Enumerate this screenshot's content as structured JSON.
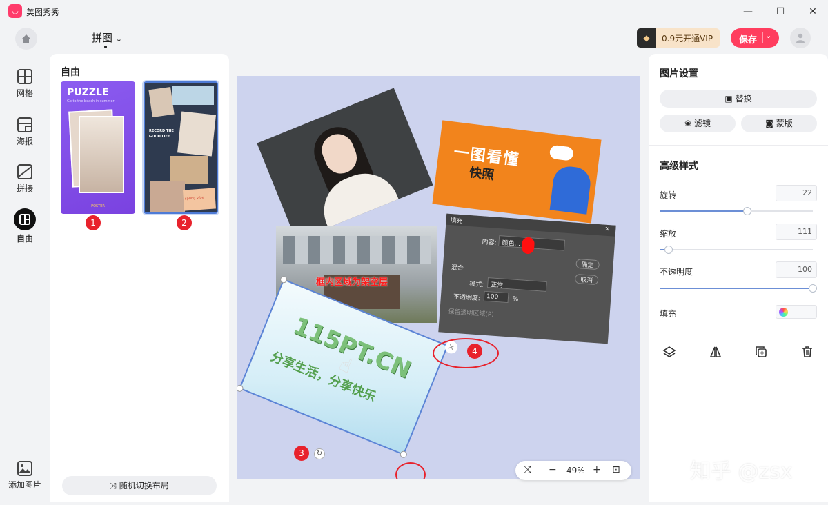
{
  "app": {
    "title": "美图秀秀",
    "logo_text": "◡"
  },
  "window": {
    "minimize": "—",
    "maximize": "☐",
    "close": "✕"
  },
  "topbar": {
    "layout_title": "拼图",
    "layout_caret": "⌄",
    "vip_text": "0.9元开通VIP",
    "save_label": "保存",
    "save_caret": "⌄"
  },
  "sidenav": {
    "items": [
      {
        "label": "网格"
      },
      {
        "label": "海报"
      },
      {
        "label": "拼接"
      },
      {
        "label": "自由"
      }
    ],
    "add_image": "添加图片"
  },
  "templates": {
    "heading": "自由",
    "cards": [
      {
        "badge": "1",
        "title": "PUZZLE",
        "subtitle": "Go to the beach in summer",
        "footer": "POSTER"
      },
      {
        "badge": "2",
        "text": "RECORD THE GOOD LIFE",
        "tag": "spring vibe"
      }
    ],
    "shuffle_label": "随机切换布局"
  },
  "canvas": {
    "banner_tag": "一图看懂",
    "banner_title": "一图看懂",
    "banner_sub": "快照",
    "overlay_red_text": "框内区域为架空层",
    "dialog": {
      "title": "填充",
      "content_label": "内容:",
      "content_value": "颜色...",
      "ok": "确定",
      "cancel": "取消",
      "blend": "混合",
      "mode_label": "模式:",
      "mode_value": "正常",
      "opacity_label": "不透明度:",
      "opacity_value": "100",
      "percent": "%",
      "keep": "保留透明区域(P)"
    },
    "selected_card": {
      "big": "115PT.CN",
      "sub": "分享生活，分享快乐"
    },
    "annotations": [
      "3",
      "4"
    ],
    "zoom": "49%"
  },
  "props": {
    "title": "图片设置",
    "replace": "替换",
    "filter": "滤镜",
    "mask": "蒙版",
    "advanced": "高级样式",
    "rotate_label": "旋转",
    "rotate_value": "22",
    "rotate_level": 0.57,
    "scale_label": "缩放",
    "scale_value": "111",
    "scale_level": 0.06,
    "opacity_label": "不透明度",
    "opacity_value": "100",
    "opacity_level": 1.0,
    "fill_label": "填充",
    "watermark": "知乎 @zsx"
  },
  "colors": {
    "accent": "#ff3d5e",
    "badge_red": "#e8222c",
    "slider_fill": "#6c8fd6",
    "canvas_bg": "#cdd3ee"
  }
}
